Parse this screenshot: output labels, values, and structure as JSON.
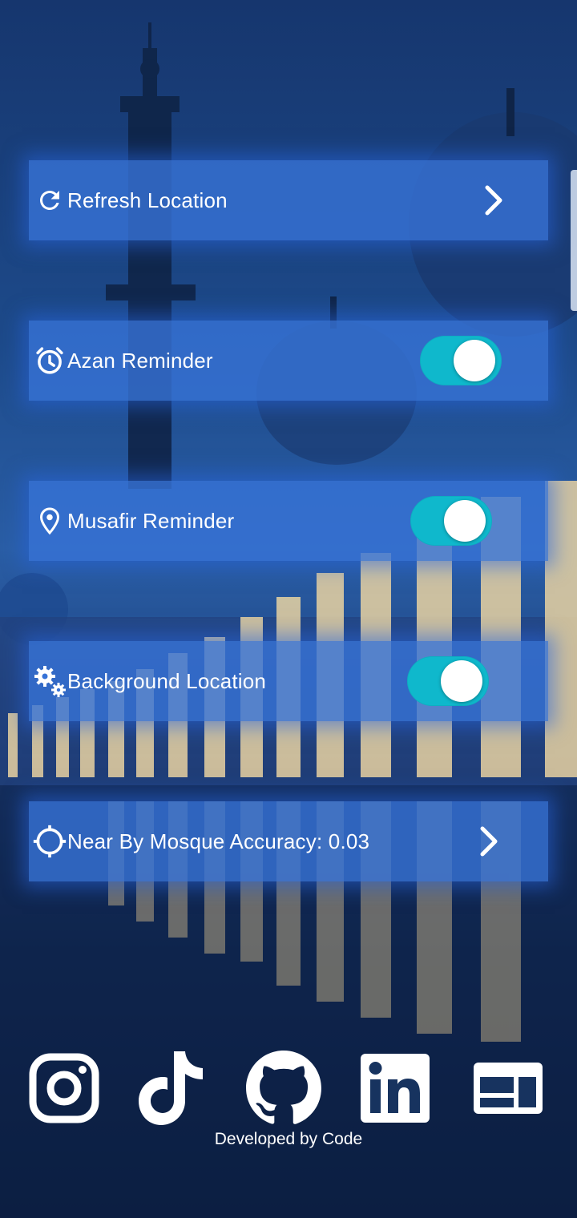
{
  "settings": {
    "refresh_location": {
      "label": "Refresh Location",
      "icon": "refresh-icon"
    },
    "azan_reminder": {
      "label": "Azan Reminder",
      "icon": "alarm-icon",
      "enabled": true
    },
    "musafir_reminder": {
      "label": "Musafir Reminder",
      "icon": "location-pin-icon",
      "enabled": true
    },
    "background_location": {
      "label": "Background Location",
      "icon": "gears-icon",
      "enabled": true
    },
    "mosque_accuracy": {
      "label": "Near By Mosque Accuracy: 0.03",
      "icon": "crosshair-icon"
    }
  },
  "social": [
    {
      "icon": "instagram-icon"
    },
    {
      "icon": "tiktok-icon"
    },
    {
      "icon": "github-icon"
    },
    {
      "icon": "linkedin-icon"
    },
    {
      "icon": "portfolio-icon"
    }
  ],
  "footer": {
    "text": "Developed by Code"
  },
  "colors": {
    "row": "#3773d7",
    "toggle_active": "#0fb8cc",
    "text": "#ffffff"
  }
}
